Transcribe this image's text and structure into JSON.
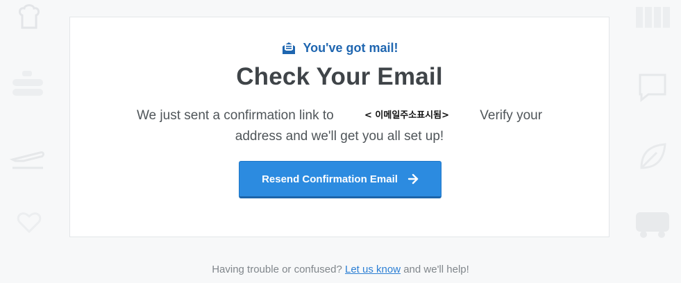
{
  "header": {
    "eyebrow": "You've got mail!",
    "title": "Check Your Email"
  },
  "message": {
    "before_email": "We just sent a confirmation link to",
    "email_placeholder": "< 이메일주소표시됨>",
    "after_email": "Verify your address and we'll get you all set up!"
  },
  "button": {
    "label": "Resend Confirmation Email",
    "icon": "arrow-right-icon"
  },
  "footer": {
    "before_link": "Having trouble or confused?",
    "link_text": "Let us know",
    "after_link": "and we'll help!"
  },
  "colors": {
    "accent": "#2c8be0",
    "eyebrow": "#1f66b0",
    "title": "#3f4448",
    "link": "#2c7fd4",
    "background": "#f7f8f9"
  },
  "background_icons": [
    "chef-icon",
    "curling-icon",
    "airplane-icon",
    "heart-icon",
    "chat-bubble-icon",
    "leaf-icon",
    "bus-icon",
    "grid-icon"
  ]
}
